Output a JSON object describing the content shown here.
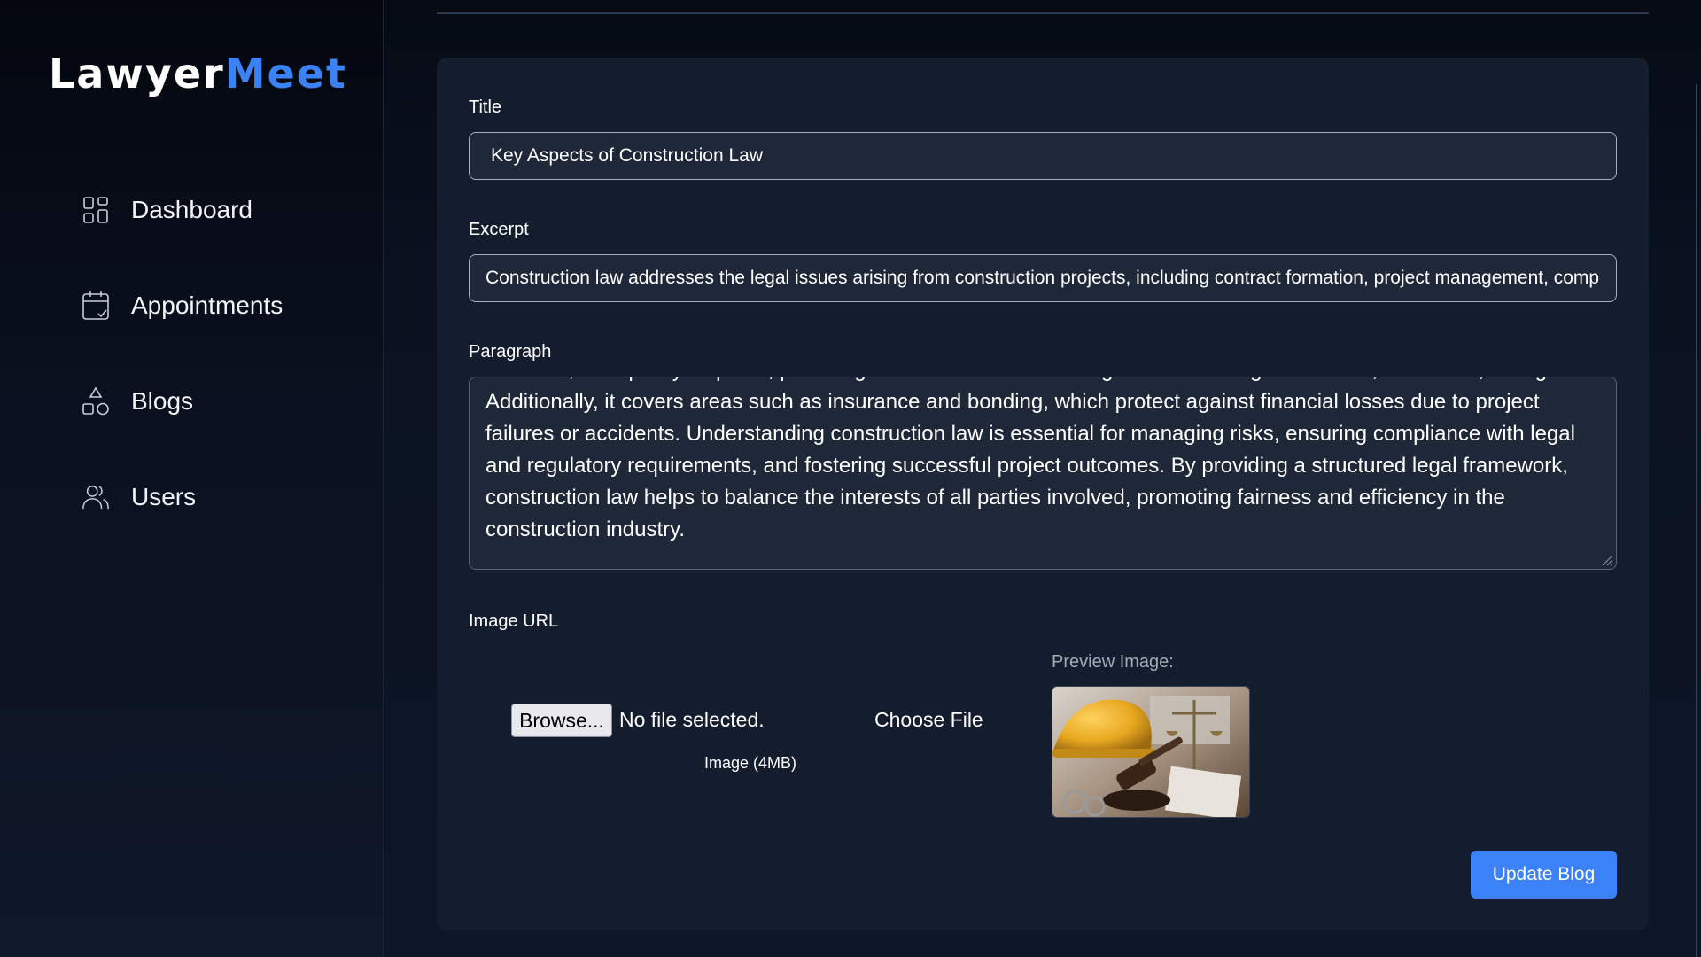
{
  "brand": {
    "part1": "Lawyer",
    "part2": "Meet"
  },
  "sidebar": {
    "items": [
      {
        "label": "Dashboard",
        "icon": "grid-icon"
      },
      {
        "label": "Appointments",
        "icon": "calendar-check-icon"
      },
      {
        "label": "Blogs",
        "icon": "shapes-icon"
      },
      {
        "label": "Users",
        "icon": "users-icon"
      }
    ]
  },
  "form": {
    "title_label": "Title",
    "title_value": "Key Aspects of Construction Law",
    "excerpt_label": "Excerpt",
    "excerpt_value": "Construction law addresses the legal issues arising from construction projects, including contract formation, project management, comp",
    "paragraph_label": "Paragraph",
    "paragraph_value": "overruns, and quality disputes, providing mechanisms for resolving conflicts through mediation, arbitration, or litigation. Additionally, it covers areas such as insurance and bonding, which protect against financial losses due to project failures or accidents. Understanding construction law is essential for managing risks, ensuring compliance with legal and regulatory requirements, and fostering successful project outcomes. By providing a structured legal framework, construction law helps to balance the interests of all parties involved, promoting fairness and efficiency in the construction industry.",
    "image_label": "Image URL",
    "browse_label": "Browse...",
    "no_file_text": "No file selected.",
    "choose_file_label": "Choose File",
    "image_hint": "Image (4MB)",
    "preview_label": "Preview Image:",
    "submit_label": "Update Blog"
  },
  "colors": {
    "accent": "#3b82f6",
    "background": "#0b1322",
    "card": "#141d2e"
  }
}
